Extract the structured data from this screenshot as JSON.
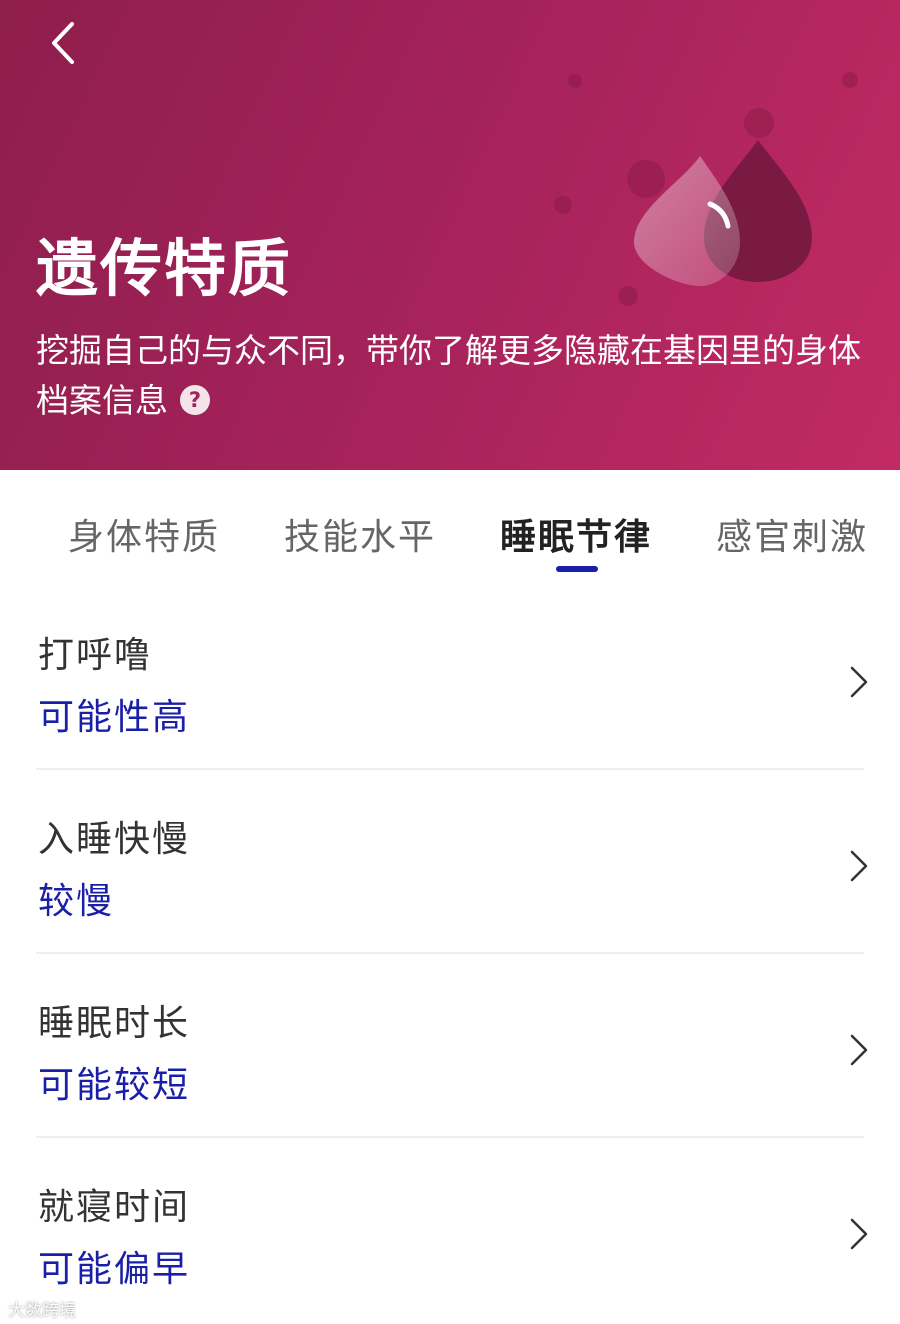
{
  "header": {
    "title": "遗传特质",
    "description": "挖掘自己的与众不同，带你了解更多隐藏在基因里的身体档案信息",
    "help_symbol": "?",
    "colors": {
      "gradient_start": "#8e1e4c",
      "gradient_end": "#c22a64"
    }
  },
  "tabs": [
    {
      "label": "身体特质",
      "active": false
    },
    {
      "label": "技能水平",
      "active": false
    },
    {
      "label": "睡眠节律",
      "active": true
    },
    {
      "label": "感官刺激",
      "active": false
    }
  ],
  "items": [
    {
      "title": "打呼噜",
      "value": "可能性高"
    },
    {
      "title": "入睡快慢",
      "value": "较慢"
    },
    {
      "title": "睡眠时长",
      "value": "可能较短"
    },
    {
      "title": "就寝时间",
      "value": "可能偏早"
    }
  ],
  "watermark": "大数跨境",
  "colors": {
    "accent": "#1a1fa8",
    "title_text": "#333333",
    "inactive_tab": "#666666"
  },
  "icons": [
    "back-arrow-icon",
    "help-icon",
    "water-drop-icon",
    "chevron-right-icon"
  ]
}
